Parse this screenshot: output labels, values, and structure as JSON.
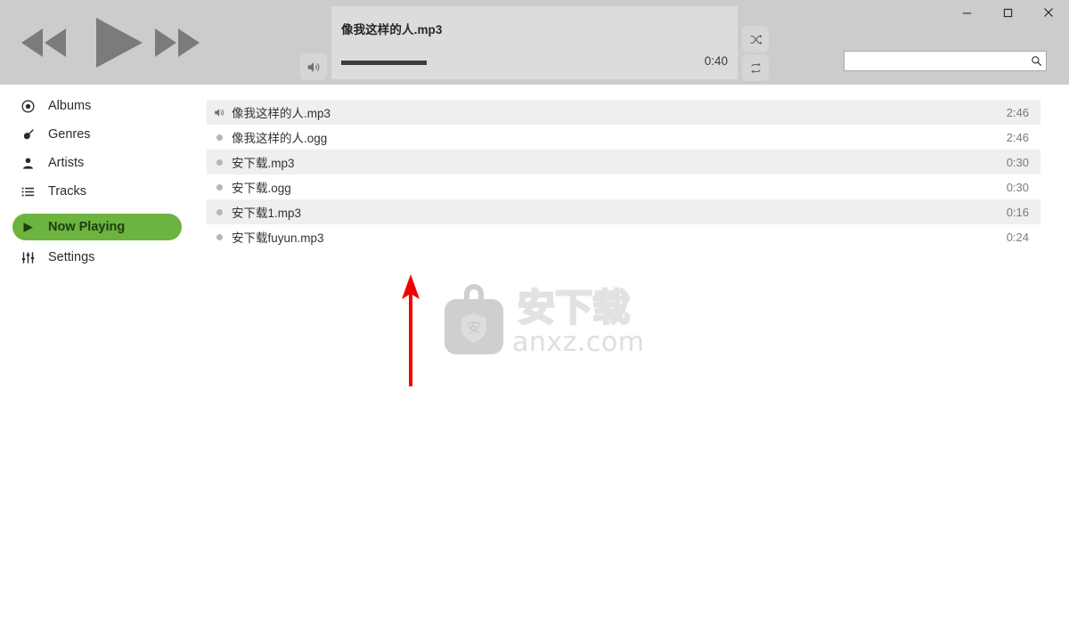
{
  "window": {
    "controls": [
      {
        "name": "minimize",
        "glyph": "minimize-icon"
      },
      {
        "name": "maximize",
        "glyph": "maximize-icon"
      },
      {
        "name": "close",
        "glyph": "close-icon"
      }
    ]
  },
  "player": {
    "prev_label": "prev-icon",
    "play_label": "play-icon",
    "next_label": "next-icon",
    "volume_label": "volume-icon",
    "now_playing_title": "像我这样的人.mp3",
    "elapsed_time": "0:40",
    "progress_percent": 24,
    "shuffle_label": "shuffle-icon",
    "repeat_label": "repeat-icon"
  },
  "search": {
    "value": "",
    "placeholder": "",
    "icon": "search-icon"
  },
  "sidebar": {
    "items": [
      {
        "label": "Albums",
        "icon": "disc-icon",
        "active": false
      },
      {
        "label": "Genres",
        "icon": "guitar-icon",
        "active": false
      },
      {
        "label": "Artists",
        "icon": "person-icon",
        "active": false
      },
      {
        "label": "Tracks",
        "icon": "list-icon",
        "active": false
      },
      {
        "label": "Now Playing",
        "icon": "play-icon",
        "active": true
      },
      {
        "label": "Settings",
        "icon": "sliders-icon",
        "active": false
      }
    ],
    "active_color": "#6cb33f"
  },
  "tracklist": {
    "rows": [
      {
        "name": "像我这样的人.mp3",
        "time": "2:46",
        "playing": true
      },
      {
        "name": "像我这样的人.ogg",
        "time": "2:46",
        "playing": false
      },
      {
        "name": "安下载.mp3",
        "time": "0:30",
        "playing": false
      },
      {
        "name": "安下载.ogg",
        "time": "0:30",
        "playing": false
      },
      {
        "name": "安下载1.mp3",
        "time": "0:16",
        "playing": false
      },
      {
        "name": "安下载fuyun.mp3",
        "time": "0:24",
        "playing": false
      }
    ]
  },
  "watermark": {
    "brand_cn": "安下载",
    "domain": "anxz.com",
    "shield_char": "安",
    "color": "#dedede"
  },
  "annotation": {
    "arrow_color": "#f20000",
    "direction": "up"
  }
}
